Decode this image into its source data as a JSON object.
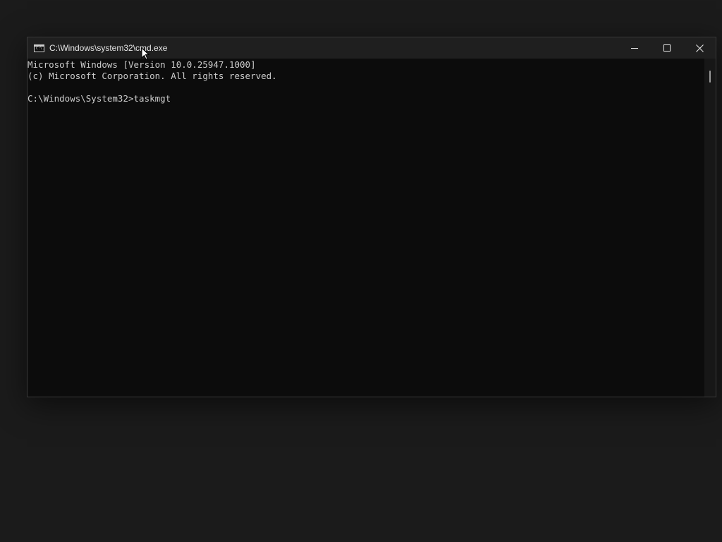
{
  "window": {
    "title": "C:\\Windows\\system32\\cmd.exe",
    "icon": "cmd-icon",
    "icon_label": "C:\\.",
    "controls": {
      "minimize": "minimize-icon",
      "maximize": "maximize-icon",
      "close": "close-icon"
    }
  },
  "console": {
    "lines": [
      "Microsoft Windows [Version 10.0.25947.1000]",
      "(c) Microsoft Corporation. All rights reserved.",
      "",
      "C:\\Windows\\System32>taskmgt"
    ]
  },
  "colors": {
    "console_background": "#0c0c0c",
    "console_text": "#cccccc",
    "titlebar": "#1f1f1f",
    "desktop": "#1b1b1b"
  }
}
